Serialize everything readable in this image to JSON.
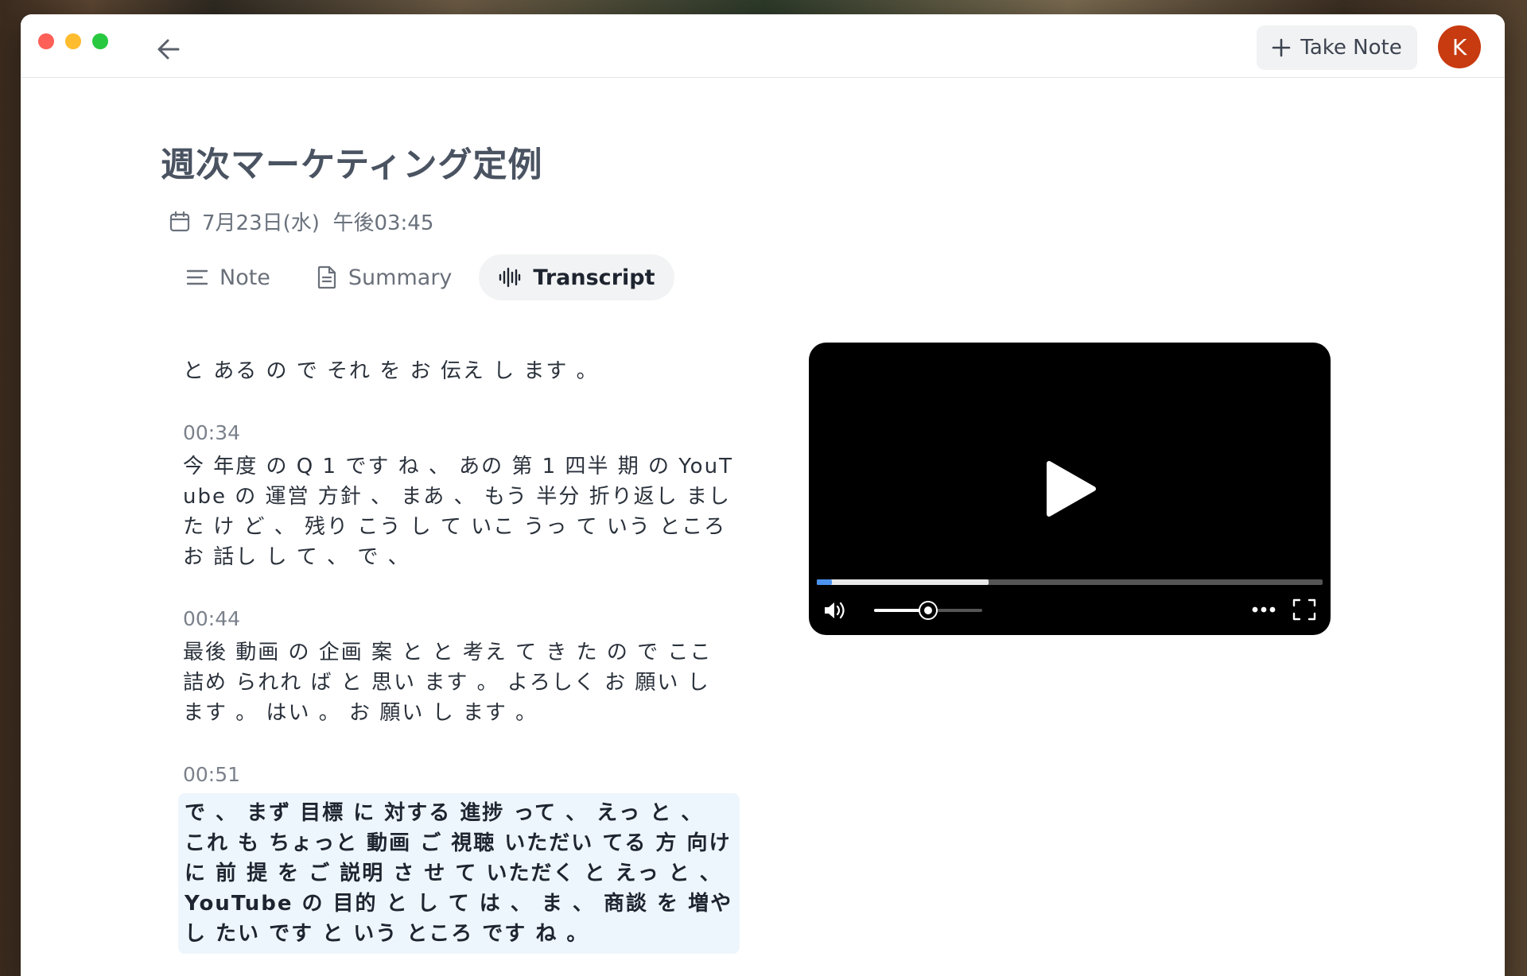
{
  "toolbar": {
    "take_note_label": "Take Note",
    "avatar_initial": "K",
    "avatar_color": "#c83a10"
  },
  "meeting": {
    "title": "週次マーケティング定例",
    "date": "7月23日(水)  午後03:45"
  },
  "tabs": [
    {
      "label": "Note",
      "icon": "lines-icon",
      "active": false
    },
    {
      "label": "Summary",
      "icon": "document-icon",
      "active": false
    },
    {
      "label": "Transcript",
      "icon": "waveform-icon",
      "active": true
    }
  ],
  "transcript": {
    "segments": [
      {
        "time": "",
        "text": "と ある の で それ を お 伝え し ます 。",
        "highlight": false
      },
      {
        "time": "00:34",
        "text": "今 年度 の Q 1 です ね 、 あの 第 1 四半 期 の YouTube の 運営 方針 、 まあ 、 もう 半分 折り返し まし た け ど 、 残り こう し て いこ うっ て いう ところ お 話し し て 、 で 、",
        "highlight": false
      },
      {
        "time": "00:44",
        "text": "最後 動画 の 企画 案 と と 考え て き た の で ここ 詰め られれ ば と 思い ます 。 よろしく お 願い し ます 。 はい 。 お 願い し ます 。",
        "highlight": false
      },
      {
        "time": "00:51",
        "text": "で 、 まず 目標 に 対する 進捗 って 、 えっ と 、 これ も ちょっと 動画 ご 視聴 いただい てる 方 向け に 前 提 を ご 説明 さ せ て いただく と えっ と 、 YouTube の 目的 と し て は 、 ま 、 商談 を 増やし たい です と いう ところ です ね 。",
        "highlight": true
      }
    ]
  },
  "player": {
    "progress_played": 0.03,
    "progress_buffered": 0.34,
    "volume": 0.5,
    "accent_color": "#4c93f0"
  }
}
